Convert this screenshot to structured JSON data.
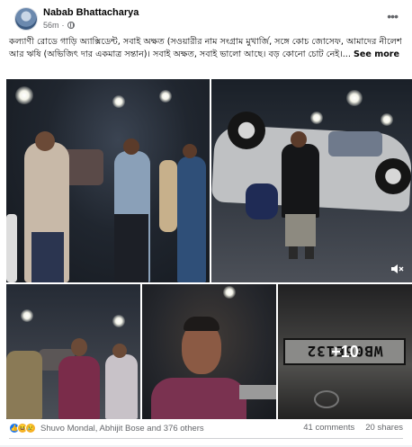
{
  "post": {
    "author": "Nabab Bhattacharya",
    "time": "56m",
    "privacy_icon": "globe-icon",
    "text": "কল্যাণী রোডে গাড়ি অ্যাক্সিডেন্ট, সবাই অক্ষত (সওয়ারীর নাম সংগ্রাম মুখার্জি, সঙ্গে কোচ জোসেফ, আমাদের নীলেশ আর ঋষি (অভিজিৎ দার একমাত্র সন্তান)। সবাই অক্ষত, সবাই ভালো আছে। বড় কোনো চোট নেই।...",
    "see_more": "See more"
  },
  "photos": {
    "more_count": "+10",
    "plate_text": "WB06E132"
  },
  "footer": {
    "reactions_text": "Shuvo Mondal, Abhijit Bose and 376 others",
    "comments": "41 comments",
    "shares": "20 shares"
  },
  "colors": {
    "like": "#1877f2",
    "haha": "#f7b125",
    "text_secondary": "#65676b"
  }
}
